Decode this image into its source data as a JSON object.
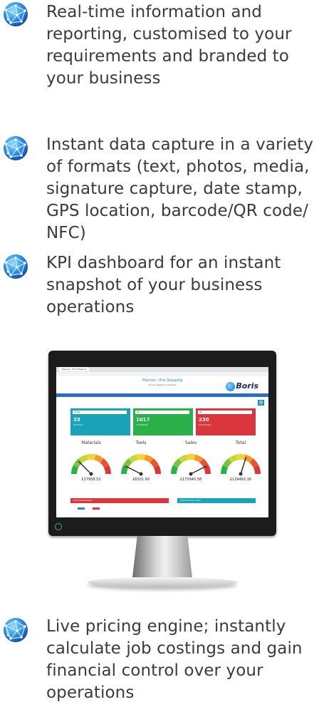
{
  "features": [
    {
      "text": "Real-time information and\nreporting, customised to your\nrequirements and branded to\nyour business",
      "icon": "globe-icon"
    },
    {
      "text": "Instant data capture in a variety\nof formats (text, photos, media,\nsignature capture, date stamp,\nGPS location, barcode/QR code/\nNFC)",
      "icon": "globe-icon"
    },
    {
      "text": "KPI dashboard for an instant\nsnapshot of your business\noperations",
      "icon": "globe-icon"
    },
    {
      "text": "Live pricing engine; instantly\ncalculate job costings and gain\nfinancial control over your\noperations",
      "icon": "globe-icon"
    }
  ],
  "dashboard": {
    "title": "Planner - Fire Stopping",
    "subtitle": "You are logged in as Demo",
    "logo": "Boris",
    "cards": [
      {
        "select": "Today",
        "value": "33",
        "label": "All Forms",
        "color": "#1aa3b8"
      },
      {
        "select": "All",
        "value": "1017",
        "label": "Completed",
        "color": "#2bb04a"
      },
      {
        "select": "All",
        "value": "230",
        "label": "Incomplete",
        "color": "#d9363e"
      }
    ],
    "gauges": [
      {
        "title": "Materials",
        "value": "£27958.52",
        "needle": 0.25
      },
      {
        "title": "Tools",
        "value": "£6501.90",
        "needle": 0.15
      },
      {
        "title": "Sales",
        "value": "£173940.58",
        "needle": 0.85
      },
      {
        "title": "Total",
        "value": "£139482.16",
        "needle": 0.6
      }
    ],
    "panels": [
      {
        "label": "Forms Breakdown",
        "color": "#d9363e"
      },
      {
        "label": "Total Monthly Sales",
        "color": "#1aa3b8"
      }
    ]
  }
}
